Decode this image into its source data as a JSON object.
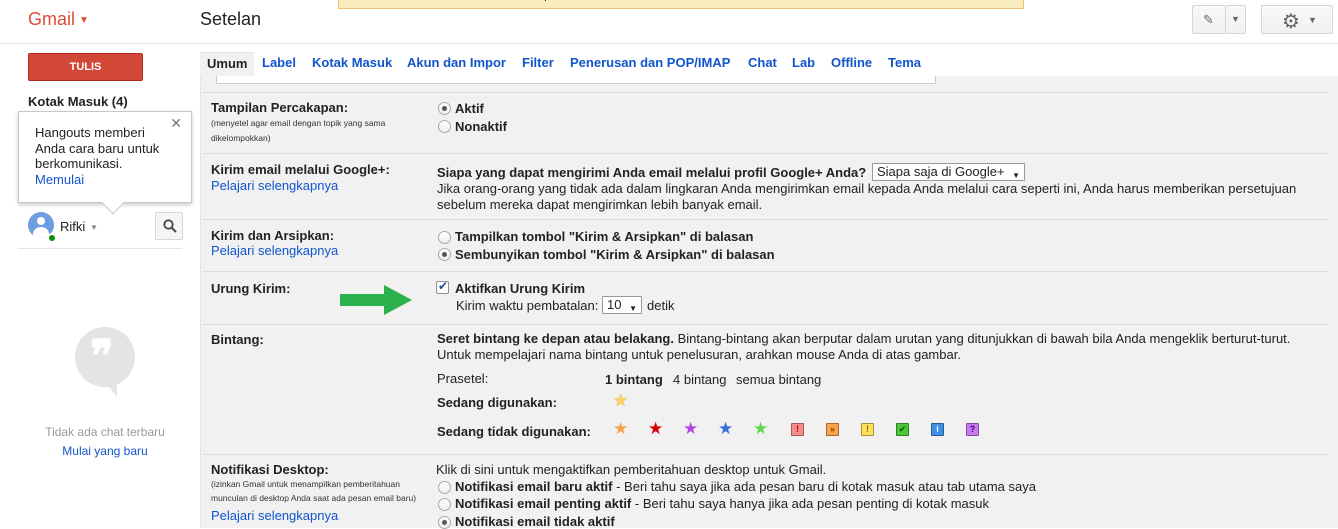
{
  "header": {
    "logo": "Gmail",
    "title": "Setelan"
  },
  "sidebar": {
    "compose_label": "TULIS",
    "inbox_label": "Kotak Masuk (4)",
    "hangouts_popup": {
      "text": "Hangouts memberi Anda cara baru untuk berkomunikasi.",
      "link": "Memulai"
    },
    "user_name": "Rifki",
    "no_chat_text": "Tidak ada chat terbaru",
    "start_chat_link": "Mulai yang baru"
  },
  "tabs": [
    "Umum",
    "Label",
    "Kotak Masuk",
    "Akun dan Impor",
    "Filter",
    "Penerusan dan POP/IMAP",
    "Chat",
    "Lab",
    "Offline",
    "Tema"
  ],
  "settings": {
    "conversation_view": {
      "label": "Tampilan Percakapan:",
      "sublabel": "(menyetel agar email dengan topik yang sama dikelompokkan)",
      "options": [
        "Aktif",
        "Nonaktif"
      ],
      "selected": "Aktif"
    },
    "google_plus": {
      "label": "Kirim email melalui Google+:",
      "learn_more": "Pelajari selengkapnya",
      "question": "Siapa yang dapat mengirimi Anda email melalui profil Google+ Anda?",
      "select_value": "Siapa saja di Google+",
      "description": "Jika orang-orang yang tidak ada dalam lingkaran Anda mengirimkan email kepada Anda melalui cara seperti ini, Anda harus memberikan persetujuan sebelum mereka dapat mengirimkan lebih banyak email."
    },
    "send_archive": {
      "label": "Kirim dan Arsipkan:",
      "learn_more": "Pelajari selengkapnya",
      "options": [
        "Tampilkan tombol \"Kirim & Arsipkan\" di balasan",
        "Sembunyikan tombol \"Kirim & Arsipkan\" di balasan"
      ],
      "selected": "Sembunyikan tombol \"Kirim & Arsipkan\" di balasan"
    },
    "undo_send": {
      "label": "Urung Kirim:",
      "checkbox_label": "Aktifkan Urung Kirim",
      "checked": true,
      "period_label": "Kirim waktu pembatalan:",
      "period_value": "10",
      "period_unit": "detik"
    },
    "stars": {
      "label": "Bintang:",
      "intro_bold": "Seret bintang ke depan atau belakang.",
      "intro_text": " Bintang-bintang akan berputar dalam urutan yang ditunjukkan di bawah bila Anda mengeklik berturut-turut. Untuk mempelajari nama bintang untuk penelusuran, arahkan mouse Anda di atas gambar.",
      "presets_label": "Prasetel:",
      "presets": [
        "1 bintang",
        "4 bintang",
        "semua bintang"
      ],
      "in_use_label": "Sedang digunakan:",
      "not_in_use_label": "Sedang tidak digunakan:",
      "in_use_icons": [
        "yellow-star"
      ],
      "not_in_use_icons": [
        "orange-star",
        "red-star",
        "purple-star",
        "blue-star",
        "green-star",
        "red-bang",
        "orange-guillemet",
        "yellow-bang",
        "green-check",
        "blue-info",
        "purple-question"
      ],
      "badge_texts": [
        "!",
        "»",
        "!",
        "✔",
        "i",
        "?"
      ]
    },
    "desktop_notifications": {
      "label": "Notifikasi Desktop:",
      "sublabel": "(izinkan Gmail untuk menampilkan pemberitahuan munculan di desktop Anda saat ada pesan email baru)",
      "learn_more": "Pelajari selengkapnya",
      "enable_link": "Klik di sini untuk mengaktifkan pemberitahuan desktop untuk Gmail.",
      "options": [
        {
          "bold": "Notifikasi email baru aktif",
          "text": " - Beri tahu saya jika ada pesan baru di kotak masuk atau tab utama saya"
        },
        {
          "bold": "Notifikasi email penting aktif",
          "text": " - Beri tahu saya hanya jika ada pesan penting di kotak masuk"
        },
        {
          "bold": "Notifikasi email tidak aktif",
          "text": ""
        }
      ],
      "selected": "Notifikasi email tidak aktif"
    }
  },
  "colors": {
    "gmail_red": "#dd4b39",
    "compose_red": "#d14836",
    "link_blue": "#1155cc",
    "panel_gray": "#f1f1f1",
    "arrow_green": "#2bb24c"
  }
}
